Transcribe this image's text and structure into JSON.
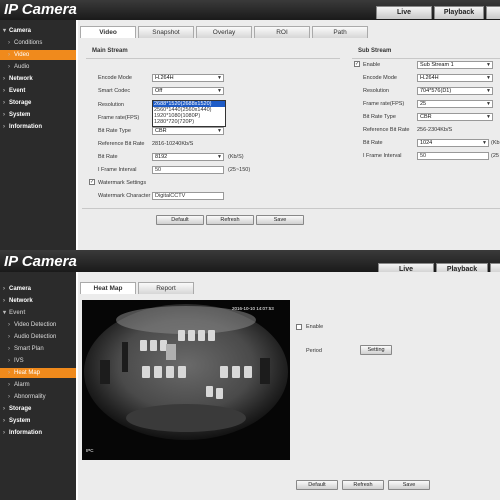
{
  "app": {
    "brand": "IP Camera"
  },
  "header": {
    "tabs": [
      "Live",
      "Playback"
    ]
  },
  "top": {
    "sidebar": [
      {
        "label": "Camera",
        "level": 1,
        "arrow": "▾"
      },
      {
        "label": "Conditions",
        "level": 2,
        "arrow": "›"
      },
      {
        "label": "Video",
        "level": 2,
        "arrow": "›"
      },
      {
        "label": "Audio",
        "level": 2,
        "arrow": "›"
      },
      {
        "label": "Network",
        "level": 1,
        "arrow": "›"
      },
      {
        "label": "Event",
        "level": 1,
        "arrow": "›"
      },
      {
        "label": "Storage",
        "level": 1,
        "arrow": "›"
      },
      {
        "label": "System",
        "level": 1,
        "arrow": "›"
      },
      {
        "label": "Information",
        "level": 1,
        "arrow": "›"
      }
    ],
    "tabs": [
      "Video",
      "Snapshot",
      "Overlay",
      "ROI",
      "Path"
    ],
    "main": {
      "title": "Main Stream",
      "encode_mode_label": "Encode Mode",
      "encode_mode": "H.264H",
      "smart_codec_label": "Smart Codec",
      "smart_codec": "Off",
      "resolution_label": "Resolution",
      "resolution_options": [
        "2688*1520(2688x1520)",
        "2560*1440(2560x1440)",
        "1920*1080(1080P)",
        "1280*720(720P)"
      ],
      "frame_rate_label": "Frame rate(FPS)",
      "bit_rate_type_label": "Bit Rate Type",
      "bit_rate_type": "CBR",
      "ref_bit_rate_label": "Reference Bit Rate",
      "ref_bit_rate": "2816-10240Kb/S",
      "bit_rate_label": "Bit Rate",
      "bit_rate": "8192",
      "bit_rate_unit": "(Kb/S)",
      "iframe_label": "I Frame Interval",
      "iframe": "50",
      "iframe_range": "(25~150)",
      "watermark_settings_label": "Watermark Settings",
      "watermark_checked": "✓",
      "watermark_char_label": "Watermark Character",
      "watermark_char": "DigitalCCTV"
    },
    "sub": {
      "title": "Sub Stream",
      "enable_label": "Enable",
      "enable_checked": "✓",
      "stream": "Sub Stream 1",
      "encode_mode_label": "Encode Mode",
      "encode_mode": "H.264H",
      "resolution_label": "Resolution",
      "resolution": "704*576(D1)",
      "frame_rate_label": "Frame rate(FPS)",
      "frame_rate": "25",
      "bit_rate_type_label": "Bit Rate Type",
      "bit_rate_type": "CBR",
      "ref_bit_rate_label": "Reference Bit Rate",
      "ref_bit_rate": "256-2304Kb/S",
      "bit_rate_label": "Bit Rate",
      "bit_rate": "1024",
      "bit_rate_unit": "(Kb",
      "iframe_label": "I Frame Interval",
      "iframe": "50",
      "iframe_range": "(25"
    },
    "buttons": {
      "default": "Default",
      "refresh": "Refresh",
      "save": "Save"
    }
  },
  "bottom": {
    "sidebar": [
      {
        "label": "Camera",
        "level": 1,
        "arrow": "›"
      },
      {
        "label": "Network",
        "level": 1,
        "arrow": "›"
      },
      {
        "label": "Event",
        "level": 1,
        "arrow": "▾"
      },
      {
        "label": "Video Detection",
        "level": 2,
        "arrow": "›"
      },
      {
        "label": "Audio Detection",
        "level": 2,
        "arrow": "›"
      },
      {
        "label": "Smart Plan",
        "level": 2,
        "arrow": "›"
      },
      {
        "label": "IVS",
        "level": 2,
        "arrow": "›"
      },
      {
        "label": "Heat Map",
        "level": 2,
        "arrow": "›"
      },
      {
        "label": "Alarm",
        "level": 2,
        "arrow": "›"
      },
      {
        "label": "Abnormality",
        "level": 2,
        "arrow": "›"
      },
      {
        "label": "Storage",
        "level": 1,
        "arrow": "›"
      },
      {
        "label": "System",
        "level": 1,
        "arrow": "›"
      },
      {
        "label": "Information",
        "level": 1,
        "arrow": "›"
      }
    ],
    "tabs": [
      "Heat Map",
      "Report"
    ],
    "video": {
      "timestamp": "2016-10-10 14:07:53",
      "channel": "IPC"
    },
    "enable_label": "Enable",
    "period_label": "Period",
    "setting_button": "Setting",
    "buttons": {
      "default": "Default",
      "refresh": "Refresh",
      "save": "Save"
    }
  },
  "colors": {
    "accent": "#f08a1c",
    "sidebar": "#2b2b2b",
    "header": "#1a1a1a",
    "selection": "#1e5bc6"
  }
}
